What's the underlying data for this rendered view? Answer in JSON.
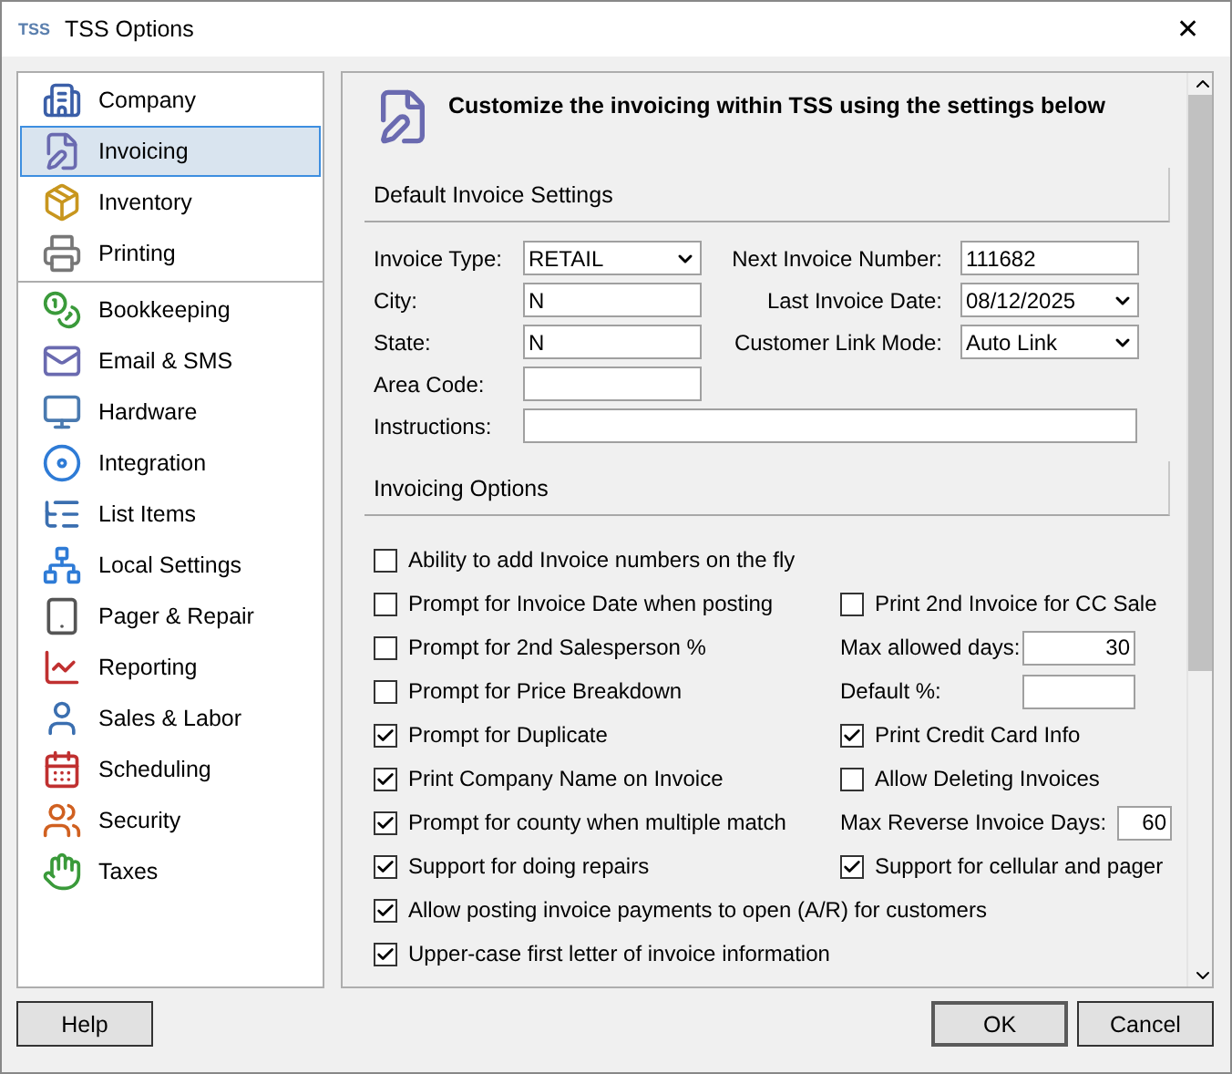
{
  "window": {
    "logo": "TSS",
    "title": "TSS Options",
    "close": "✕"
  },
  "sidebar": {
    "groups": [
      [
        {
          "label": "Company",
          "selected": false
        },
        {
          "label": "Invoicing",
          "selected": true
        },
        {
          "label": "Inventory",
          "selected": false
        },
        {
          "label": "Printing",
          "selected": false
        }
      ],
      [
        {
          "label": "Bookkeeping",
          "selected": false
        },
        {
          "label": "Email & SMS",
          "selected": false
        },
        {
          "label": "Hardware",
          "selected": false
        },
        {
          "label": "Integration",
          "selected": false
        },
        {
          "label": "List Items",
          "selected": false
        },
        {
          "label": "Local Settings",
          "selected": false
        },
        {
          "label": "Pager & Repair",
          "selected": false
        },
        {
          "label": "Reporting",
          "selected": false
        },
        {
          "label": "Sales & Labor",
          "selected": false
        },
        {
          "label": "Scheduling",
          "selected": false
        },
        {
          "label": "Security",
          "selected": false
        },
        {
          "label": "Taxes",
          "selected": false
        }
      ]
    ]
  },
  "header": "Customize the invoicing within TSS using the settings below",
  "defaults": {
    "title": "Default Invoice Settings",
    "left": [
      {
        "label": "Invoice Type:",
        "value": "RETAIL",
        "kind": "dropdown"
      },
      {
        "label": "City:",
        "value": "N",
        "kind": "text"
      },
      {
        "label": "State:",
        "value": "N",
        "kind": "text"
      },
      {
        "label": "Area Code:",
        "kind": "text"
      }
    ],
    "right": [
      {
        "label": "Next Invoice Number:",
        "value": "111682",
        "kind": "text"
      },
      {
        "label": "Last Invoice Date:",
        "value": "08/12/2025",
        "kind": "dropdown"
      },
      {
        "label": "Customer Link Mode:",
        "value": "Auto Link",
        "kind": "dropdown"
      }
    ],
    "instructions": {
      "label": "Instructions:"
    }
  },
  "options": {
    "title": "Invoicing Options",
    "rows": [
      {
        "left": {
          "label": "Ability to add Invoice numbers on the fly",
          "checked": false
        }
      },
      {
        "left": {
          "label": "Prompt for Invoice Date when posting",
          "checked": false
        },
        "right": {
          "kind": "checkbox",
          "label": "Print 2nd Invoice for CC Sale",
          "checked": false
        }
      },
      {
        "left": {
          "label": "Prompt for 2nd Salesperson %",
          "checked": false
        },
        "right": {
          "kind": "field",
          "label": "Max allowed days:",
          "value": "30"
        }
      },
      {
        "left": {
          "label": "Prompt for Price Breakdown",
          "checked": false
        },
        "right": {
          "kind": "field",
          "label": "Default %:"
        }
      },
      {
        "left": {
          "label": "Prompt for Duplicate",
          "checked": true
        },
        "right": {
          "kind": "checkbox",
          "label": "Print Credit Card Info",
          "checked": true
        }
      },
      {
        "left": {
          "label": "Print Company Name on Invoice",
          "checked": true
        },
        "right": {
          "kind": "checkbox",
          "label": "Allow Deleting Invoices",
          "checked": false
        }
      },
      {
        "left": {
          "label": "Prompt for county when multiple match",
          "checked": true
        },
        "right": {
          "kind": "narrowfield",
          "label": "Max Reverse Invoice Days:",
          "value": "60"
        }
      },
      {
        "left": {
          "label": "Support for doing repairs",
          "checked": true
        },
        "right": {
          "kind": "checkbox",
          "label": "Support for cellular and pager",
          "checked": true
        }
      },
      {
        "left": {
          "label": "Allow posting invoice payments to open (A/R) for customers",
          "checked": true
        }
      },
      {
        "left": {
          "label": "Upper-case first letter of invoice information",
          "checked": true
        }
      }
    ]
  },
  "buttons": {
    "help": "Help",
    "ok": "OK",
    "cancel": "Cancel"
  }
}
